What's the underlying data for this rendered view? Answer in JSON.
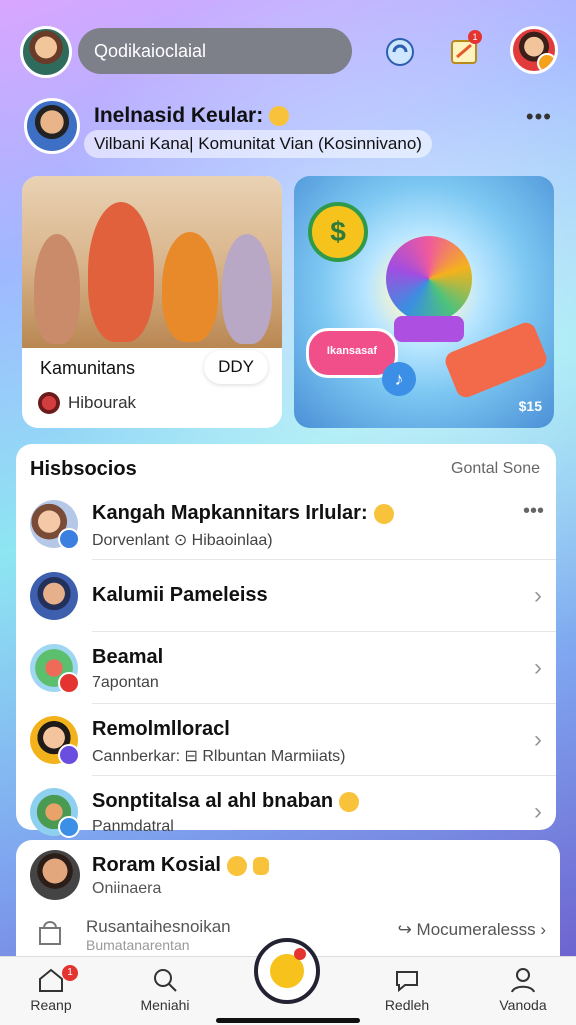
{
  "top": {
    "search_placeholder": "Qodikaioclaial",
    "badge_count": "1"
  },
  "user": {
    "name": "Inelnasid Keular:",
    "subtitle": "Vilbani Kana| Komunitat Vian (Kosinnivano)",
    "more": "•••"
  },
  "cards": {
    "left": {
      "label": "Kamunitans",
      "pill": "DDY",
      "footer": "Hibourak"
    },
    "right": {
      "coin": "$",
      "tag": "Ikansasaf",
      "price": "$15"
    }
  },
  "list": {
    "title": "Hisbsocios",
    "link": "Gontal Sone",
    "items": [
      {
        "title": "Kangah Mapkannitars Irlular:",
        "subtitle": "Dorvenlant  ⊙ Hibaoinlaa)",
        "action": "more"
      },
      {
        "title": "Kalumii Pameleiss",
        "subtitle": "",
        "action": "chevron"
      },
      {
        "title": "Beamal",
        "subtitle": "7apontan",
        "action": "chevron"
      },
      {
        "title": "Remolmlloracl",
        "subtitle": "Cannberkar: ⊟ Rlbuntan Marmiiats)",
        "action": "chevron"
      },
      {
        "title": "Sonptitalsa al ahl bnaban",
        "subtitle": "Panmdatral",
        "action": "chevron"
      }
    ]
  },
  "bottom_panel": {
    "name": "Roram Kosial",
    "status": "Oniinaera",
    "action_text": "Rusantaihesnoikan",
    "action_sub": "Bumatanarentan",
    "link_text": "Mocumeralesss"
  },
  "nav": {
    "items": [
      {
        "label": "Reanp",
        "badge": "1"
      },
      {
        "label": "Meniahi"
      },
      {
        "label": "Redleh"
      },
      {
        "label": "Vanoda"
      }
    ]
  },
  "colors": {
    "accent": "#e3342f",
    "search_bg": "#7d7f89",
    "coin": "#f6c31c"
  }
}
